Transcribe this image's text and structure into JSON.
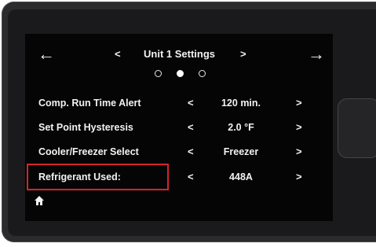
{
  "header": {
    "title": "Unit 1 Settings",
    "back_icon": "arrow-left-icon",
    "forward_icon": "arrow-right-icon",
    "prev_icon": "chevron-left-icon",
    "next_icon": "chevron-right-icon"
  },
  "pager": {
    "page_count": 3,
    "active_page": 2
  },
  "settings": [
    {
      "label": "Comp. Run Time Alert",
      "value": "120 min."
    },
    {
      "label": "Set Point Hysteresis",
      "value": "2.0 °F"
    },
    {
      "label": "Cooler/Freezer Select",
      "value": "Freezer"
    },
    {
      "label": "Refrigerant Used:",
      "value": "448A"
    }
  ],
  "glyphs": {
    "left": "<",
    "right": ">",
    "arrow_left": "←",
    "arrow_right": "→",
    "home": "⌂"
  },
  "annotation": {
    "highlight_color": "#d6252b",
    "highlighted_row": "Refrigerant Used:"
  },
  "footer": {
    "home_icon": "home-icon"
  }
}
